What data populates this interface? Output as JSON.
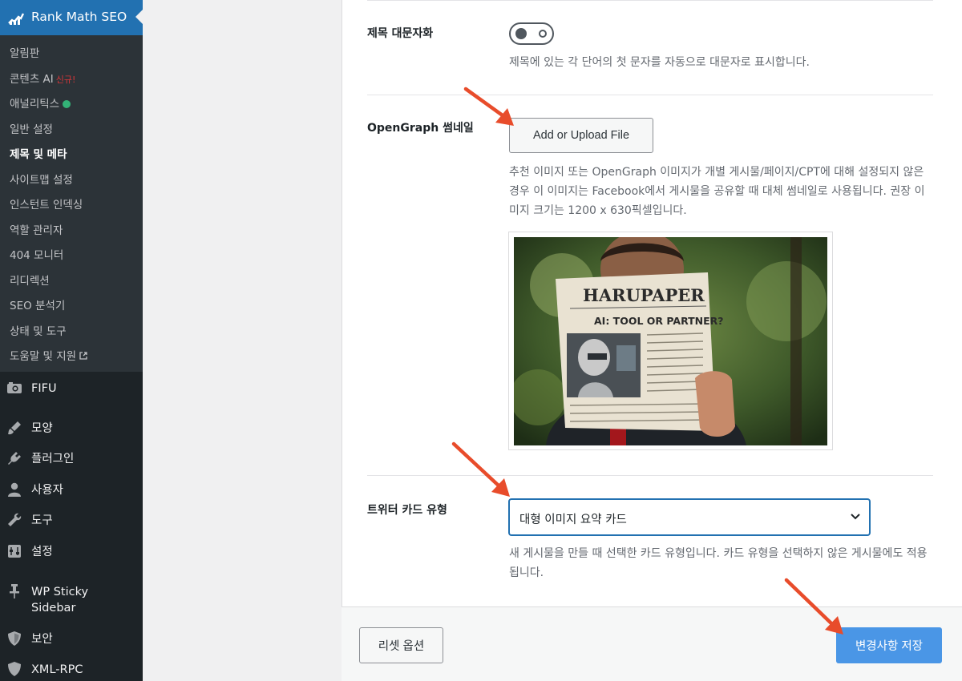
{
  "sidebar": {
    "plugin_title": "Rank Math SEO",
    "submenu": [
      {
        "label": "알림판"
      },
      {
        "label": "콘텐츠 AI",
        "badge": "신규!"
      },
      {
        "label": "애널리틱스",
        "status": "green"
      },
      {
        "label": "일반 설정"
      },
      {
        "label": "제목 및 메타",
        "current": true
      },
      {
        "label": "사이트맵 설정"
      },
      {
        "label": "인스턴트 인덱싱"
      },
      {
        "label": "역할 관리자"
      },
      {
        "label": "404 모니터"
      },
      {
        "label": "리디렉션"
      },
      {
        "label": "SEO 분석기"
      },
      {
        "label": "상태 및 도구"
      },
      {
        "label": "도움말 및 지원",
        "external": true
      }
    ],
    "menu": [
      {
        "label": "FIFU",
        "icon": "camera-icon"
      },
      {
        "label": "모양",
        "icon": "brush-icon"
      },
      {
        "label": "플러그인",
        "icon": "plugin-icon"
      },
      {
        "label": "사용자",
        "icon": "user-icon"
      },
      {
        "label": "도구",
        "icon": "wrench-icon"
      },
      {
        "label": "설정",
        "icon": "settings-icon"
      },
      {
        "label": "WP Sticky Sidebar",
        "label_lines": [
          "WP Sticky",
          "Sidebar"
        ],
        "icon": "pin-icon"
      },
      {
        "label": "보안",
        "icon": "shield-icon"
      },
      {
        "label": "XML-RPC",
        "icon": "shield-icon"
      }
    ]
  },
  "settings": {
    "capitalize_titles": {
      "label": "제목 대문자화",
      "enabled": false,
      "description": "제목에 있는 각 단어의 첫 문자를 자동으로 대문자로 표시합니다."
    },
    "opengraph_thumbnail": {
      "label": "OpenGraph 썸네일",
      "button_label": "Add or Upload File",
      "description": "추천 이미지 또는 OpenGraph 이미지가 개별 게시물/페이지/CPT에 대해 설정되지 않은 경우 이 이미지는 Facebook에서 게시물을 공유할 때 대체 썸네일로 사용됩니다. 권장 이미지 크기는 1200 x 630픽셀입니다.",
      "preview": {
        "masthead": "HARUPAPER",
        "headline": "AI: TOOL OR PARTNER?"
      }
    },
    "twitter_card_type": {
      "label": "트위터 카드 유형",
      "selected": "대형 이미지 요약 카드",
      "description": "새 게시물을 만들 때 선택한 카드 유형입니다. 카드 유형을 선택하지 않은 게시물에도 적용됩니다."
    }
  },
  "footer": {
    "reset_label": "리셋 옵션",
    "save_label": "변경사항 저장"
  },
  "colors": {
    "admin_sidebar": "#1d2327",
    "submenu_bg": "#2c3338",
    "accent": "#2271b1",
    "save_button": "#4a96e6",
    "annotation_arrow": "#e84c2b"
  }
}
